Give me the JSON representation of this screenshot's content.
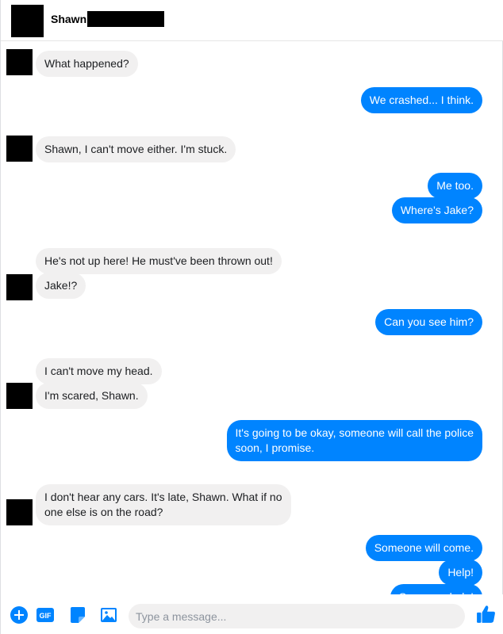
{
  "header": {
    "contact_name": "Shawn"
  },
  "composer": {
    "placeholder": "Type a message...",
    "icons": [
      "plus-icon",
      "gif-icon",
      "sticker-icon",
      "image-icon",
      "emoji-icon",
      "thumbs-up-icon"
    ],
    "gif_label": "GIF"
  },
  "colors": {
    "accent": "#0084ff",
    "incoming_bubble": "#f1f0f0"
  },
  "messages": [
    {
      "dir": "in",
      "text": "What happened?"
    },
    {
      "dir": "out",
      "text": "We crashed... I think."
    },
    {
      "dir": "in",
      "text": "Shawn, I can't move either. I'm stuck."
    },
    {
      "dir": "out",
      "text": "Me too."
    },
    {
      "dir": "out",
      "text": "Where's Jake?"
    },
    {
      "dir": "in",
      "text": "He's not up here! He must've been thrown out!"
    },
    {
      "dir": "in",
      "text": "Jake!?"
    },
    {
      "dir": "out",
      "text": "Can you see him?"
    },
    {
      "dir": "in",
      "text": "I can't move my head."
    },
    {
      "dir": "in",
      "text": "I'm scared, Shawn."
    },
    {
      "dir": "out",
      "text": "It's going to be okay, someone will call the police\nsoon, I promise."
    },
    {
      "dir": "in",
      "text": "I don't hear any cars. It's late, Shawn. What if no\none else is on the road?"
    },
    {
      "dir": "out",
      "text": "Someone will come."
    },
    {
      "dir": "out",
      "text": "Help!"
    },
    {
      "dir": "out",
      "text": "Someone help!"
    }
  ]
}
